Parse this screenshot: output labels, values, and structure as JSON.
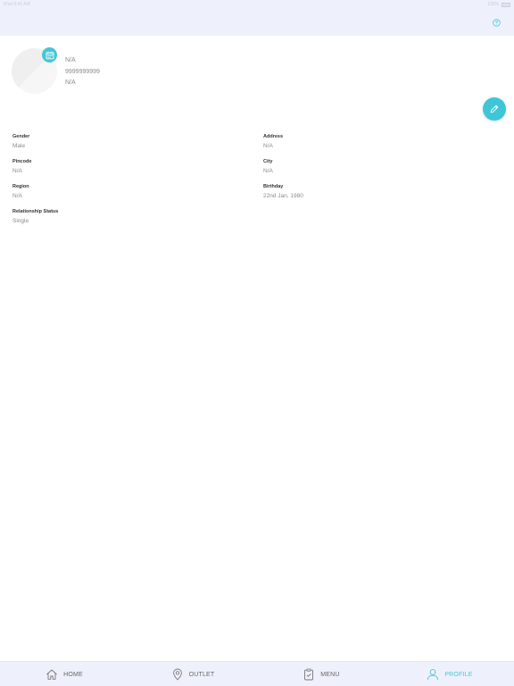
{
  "status_bar": {
    "left": "iPad  9:41 AM",
    "right": "100%"
  },
  "colors": {
    "accent": "#45c6d6",
    "header_bg": "#eef1fb",
    "label": "#333333",
    "value": "#8b8b8b"
  },
  "profile": {
    "name": "N/A",
    "phone": "9999999999",
    "email": "N/A"
  },
  "fields": {
    "gender": {
      "label": "Gender",
      "value": "Male"
    },
    "address": {
      "label": "Address",
      "value": "N/A"
    },
    "pincode": {
      "label": "Pincode",
      "value": "N/A"
    },
    "city": {
      "label": "City",
      "value": "N/A"
    },
    "region": {
      "label": "Region",
      "value": "N/A"
    },
    "birthday": {
      "label": "Birthday",
      "value": "22nd Jan, 1980"
    },
    "relationship": {
      "label": "Relationship Status",
      "value": "Single"
    }
  },
  "nav": {
    "home": "HOME",
    "outlet": "OUTLET",
    "menu": "MENU",
    "profile": "PROFILE",
    "active": "profile"
  },
  "icons": {
    "help": "question-circle-icon",
    "avatar_badge": "calendar-icon",
    "edit": "pencil-icon",
    "home": "home-icon",
    "outlet": "location-pin-icon",
    "menu": "clipboard-check-icon",
    "profile": "user-icon"
  }
}
